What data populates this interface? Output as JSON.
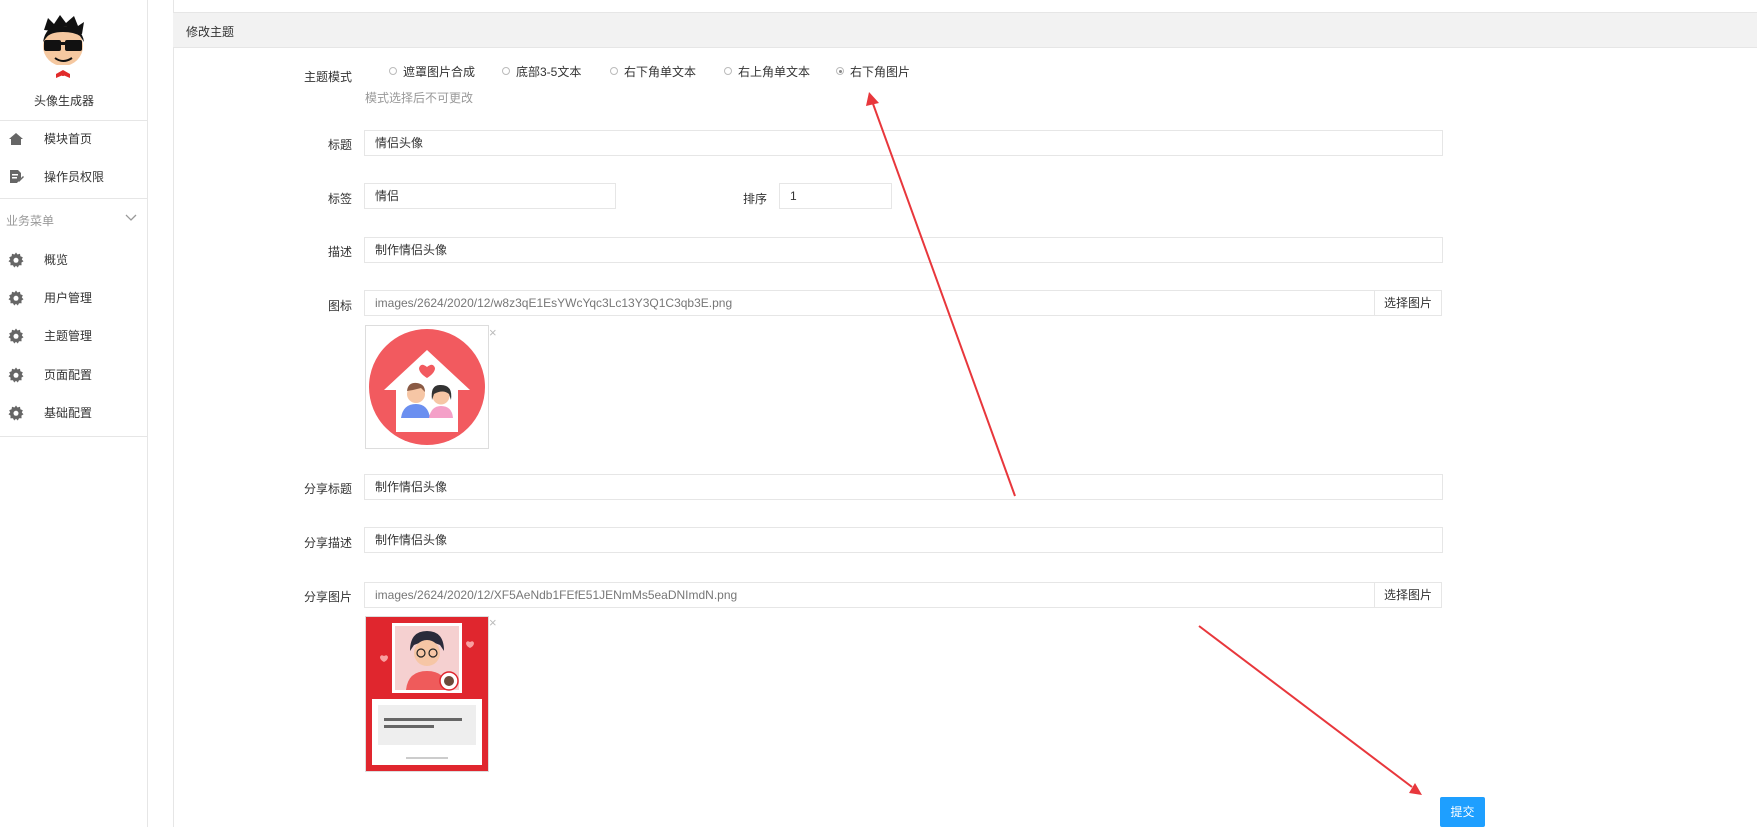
{
  "app": {
    "name": "头像生成器"
  },
  "sidebar": {
    "top_items": [
      {
        "label": "模块首页",
        "icon": "home-icon"
      },
      {
        "label": "操作员权限",
        "icon": "doc-edit-icon"
      }
    ],
    "section_title": "业务菜单",
    "items": [
      {
        "label": "概览",
        "icon": "gear-icon"
      },
      {
        "label": "用户管理",
        "icon": "gear-icon"
      },
      {
        "label": "主题管理",
        "icon": "gear-icon"
      },
      {
        "label": "页面配置",
        "icon": "gear-icon"
      },
      {
        "label": "基础配置",
        "icon": "gear-icon"
      }
    ]
  },
  "panel": {
    "title": "修改主题"
  },
  "form": {
    "mode": {
      "label": "主题模式",
      "options": [
        "遮罩图片合成",
        "底部3-5文本",
        "右下角单文本",
        "右上角单文本",
        "右下角图片"
      ],
      "selected": "右下角图片",
      "hint": "模式选择后不可更改"
    },
    "title": {
      "label": "标题",
      "value": "情侣头像"
    },
    "tag": {
      "label": "标签",
      "value": "情侣"
    },
    "sort": {
      "label": "排序",
      "value": "1"
    },
    "desc": {
      "label": "描述",
      "value": "制作情侣头像"
    },
    "icon": {
      "label": "图标",
      "value": "images/2624/2020/12/w8z3qE1EsYWcYqc3Lc13Y3Q1C3qb3E.png",
      "pick_label": "选择图片"
    },
    "share_title": {
      "label": "分享标题",
      "value": "制作情侣头像"
    },
    "share_desc": {
      "label": "分享描述",
      "value": "制作情侣头像"
    },
    "share_image": {
      "label": "分享图片",
      "value": "images/2624/2020/12/XF5AeNdb1FEfE51JENmMs5eaDNImdN.png",
      "pick_label": "选择图片"
    },
    "close_glyph": "×",
    "submit_label": "提交"
  },
  "colors": {
    "primary": "#1e9fff",
    "annotation_arrow": "#e8373c",
    "icon_red": "#f25a5f"
  }
}
